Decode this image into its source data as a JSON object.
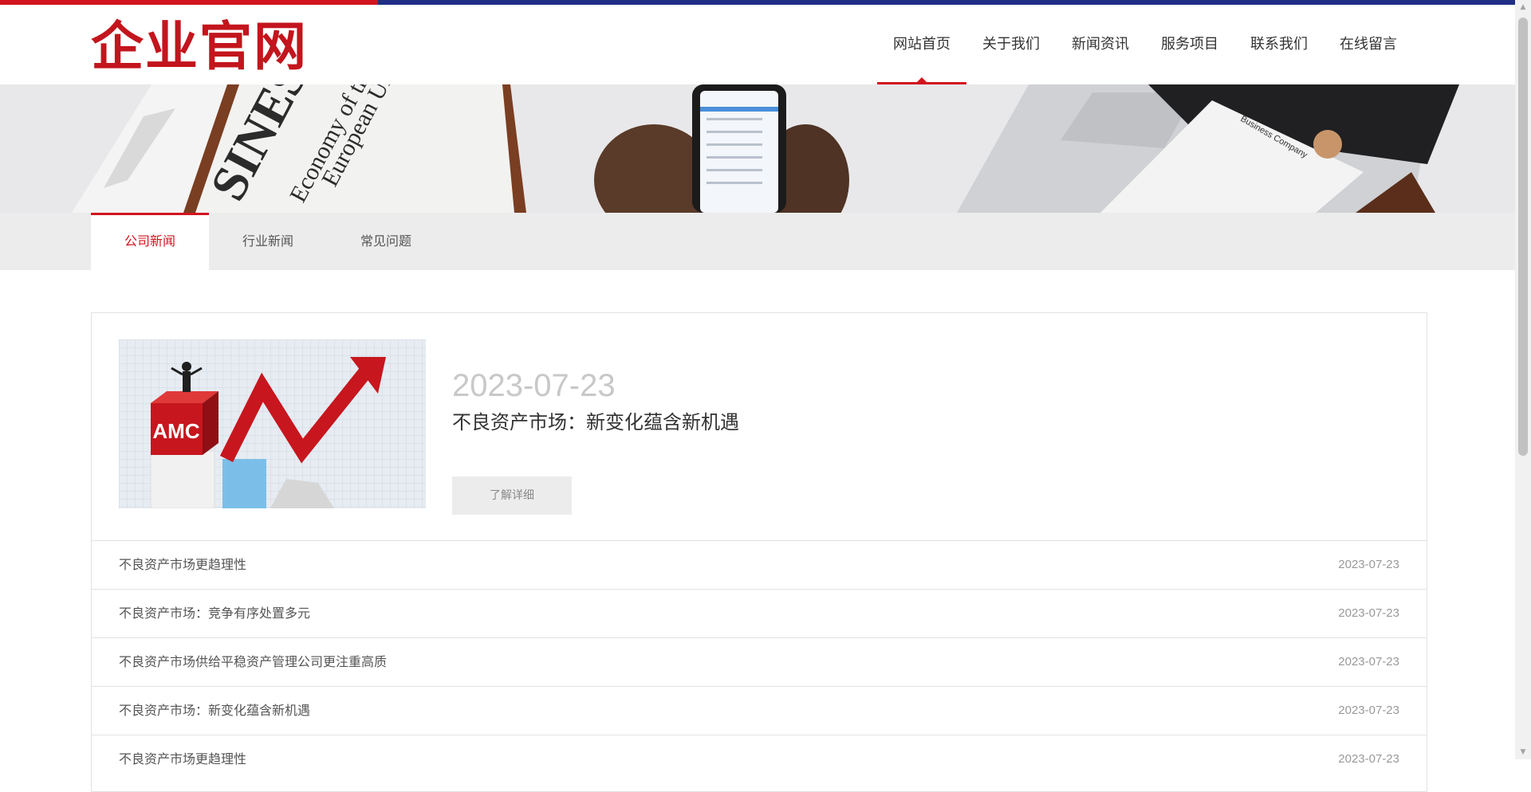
{
  "site": {
    "logo_text": "企业官网",
    "colors": {
      "primary_red": "#d2141f",
      "navy": "#1f2f86",
      "logo_red": "#c3151d"
    }
  },
  "nav": {
    "items": [
      {
        "label": "网站首页",
        "active": true
      },
      {
        "label": "关于我们",
        "active": false
      },
      {
        "label": "新闻资讯",
        "active": false
      },
      {
        "label": "服务项目",
        "active": false
      },
      {
        "label": "联系我们",
        "active": false
      },
      {
        "label": "在线留言",
        "active": false
      }
    ]
  },
  "banner": {
    "newspaper_words": [
      "SINESS",
      "Economy of th",
      "European Uni"
    ],
    "clipboard_text": "Business Company"
  },
  "subnav": {
    "tabs": [
      {
        "label": "公司新闻",
        "active": true
      },
      {
        "label": "行业新闻",
        "active": false
      },
      {
        "label": "常见问题",
        "active": false
      }
    ]
  },
  "featured": {
    "image_badge": "AMC",
    "date": "2023-07-23",
    "title": "不良资产市场：新变化蕴含新机遇",
    "button_label": "了解详细"
  },
  "news_list": [
    {
      "title": "不良资产市场更趋理性",
      "date": "2023-07-23"
    },
    {
      "title": "不良资产市场：竞争有序处置多元",
      "date": "2023-07-23"
    },
    {
      "title": "不良资产市场供给平稳资产管理公司更注重高质",
      "date": "2023-07-23"
    },
    {
      "title": "不良资产市场：新变化蕴含新机遇",
      "date": "2023-07-23"
    },
    {
      "title": "不良资产市场更趋理性",
      "date": "2023-07-23"
    }
  ],
  "scrollbar": {
    "up_icon": "arrow-up-icon",
    "down_icon": "arrow-down-icon"
  }
}
